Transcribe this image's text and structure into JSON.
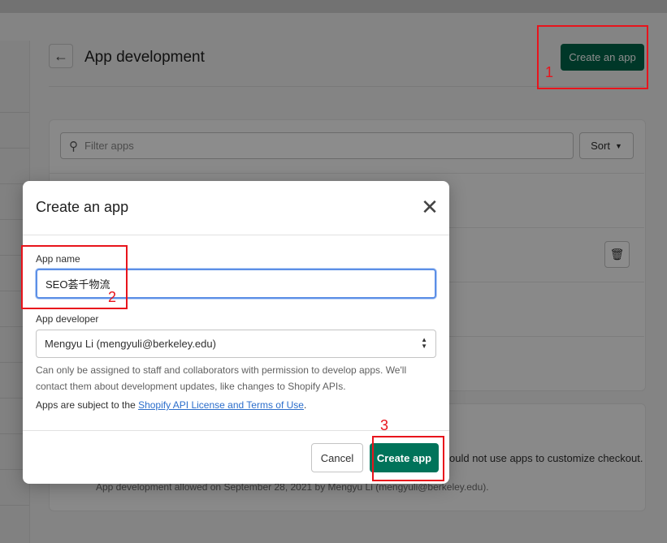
{
  "page": {
    "title": "App development",
    "back_icon": "arrow-left-icon",
    "create_app_button": "Create an app",
    "filter_placeholder": "Filter apps",
    "sort_label": "Sort",
    "checkout_text": "ould not use apps to customize checkout.",
    "allowed_text": "App development allowed on September 28, 2021 by Mengyu Li (mengyuli@berkeley.edu)."
  },
  "modal": {
    "title": "Create an app",
    "close_icon": "close-icon",
    "app_name_label": "App name",
    "app_name_value": "SEO荟千物流",
    "app_developer_label": "App developer",
    "app_developer_value": "Mengyu Li (mengyuli@berkeley.edu)",
    "help_text": "Can only be assigned to staff and collaborators with permission to develop apps. We'll contact them about development updates, like changes to Shopify APIs.",
    "terms_prefix": "Apps are subject to the ",
    "terms_link": "Shopify API License and Terms of Use",
    "terms_suffix": ".",
    "cancel_label": "Cancel",
    "create_label": "Create app"
  },
  "annotations": {
    "step1": "1",
    "step2": "2",
    "step3": "3",
    "color": "#e8141c"
  },
  "colors": {
    "primary": "#00654a",
    "focus": "#5c8fe6",
    "link": "#2c6ecb"
  }
}
